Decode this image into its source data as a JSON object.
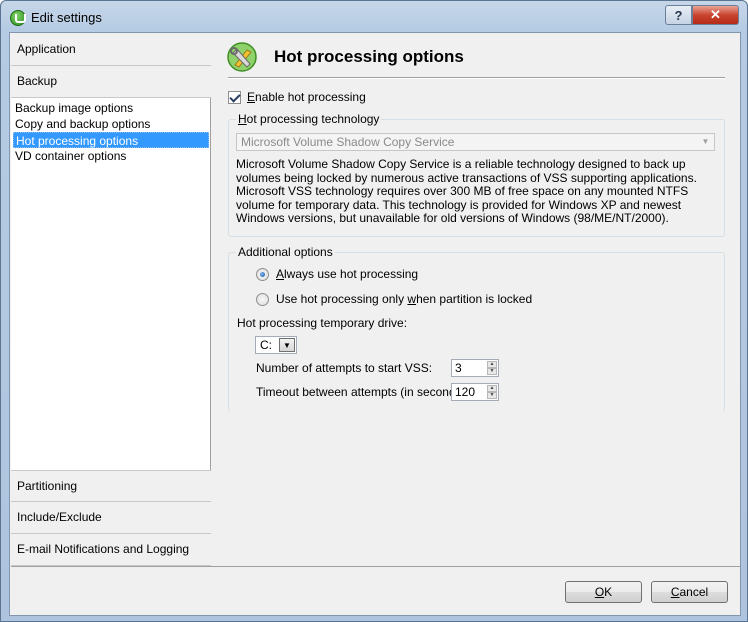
{
  "window": {
    "title": "Edit settings"
  },
  "nav": {
    "categories_top": [
      {
        "label": "Application"
      },
      {
        "label": "Backup"
      }
    ],
    "sub_items": [
      {
        "label": "Backup image options"
      },
      {
        "label": "Copy and backup options"
      },
      {
        "label": "Hot processing options",
        "selected": true
      },
      {
        "label": "VD container options"
      }
    ],
    "categories_bottom": [
      {
        "label": "Partitioning"
      },
      {
        "label": "Include/Exclude"
      },
      {
        "label": "E-mail Notifications and Logging"
      }
    ]
  },
  "page": {
    "title": "Hot processing options",
    "icon": "wrench-tools-icon",
    "enable_hot_processing": {
      "pre": "",
      "accel": "E",
      "post": "nable hot processing",
      "checked": true
    },
    "technology_group": {
      "title": "Hot processing technology",
      "selected": "Microsoft Volume Shadow Copy Service",
      "description": "Microsoft Volume Shadow Copy Service is a reliable technology designed to back up volumes being locked by numerous active transactions of VSS supporting applications. Microsoft VSS technology requires over 300 MB of free space on any mounted NTFS volume for temporary data. This technology is provided for Windows XP and newest Windows versions, but unavailable for old versions of Windows (98/ME/NT/2000)."
    },
    "additional_group": {
      "title": "Additional options",
      "radio_always": {
        "pre": "",
        "accel": "A",
        "post": "lways use hot processing",
        "checked": true
      },
      "radio_when_locked": {
        "pre": "Use hot processing only ",
        "accel": "w",
        "post": "hen partition is locked",
        "checked": false
      },
      "temp_drive_label": "Hot processing temporary drive:",
      "temp_drive_value": "C:",
      "attempts_label": "Number of attempts to start VSS:",
      "attempts_value": "3",
      "timeout_label": "Timeout between attempts (in seconds):",
      "timeout_value": "120"
    }
  },
  "buttons": {
    "ok": {
      "accel": "O",
      "post": "K"
    },
    "cancel": {
      "accel": "C",
      "post": "ancel"
    }
  },
  "colors": {
    "selection": "#3399ff",
    "dialog_bg": "#f0f0f0",
    "close_button": "#c94430"
  }
}
